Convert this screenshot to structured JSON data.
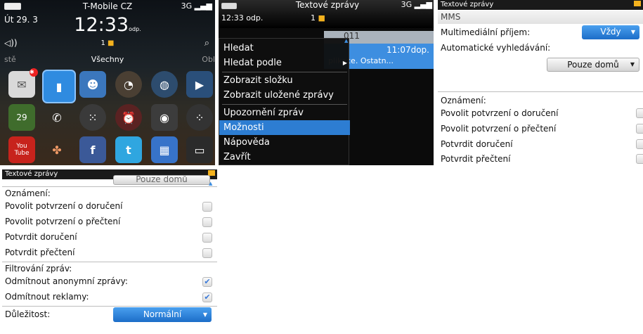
{
  "screen1": {
    "date": "Út 29. 3",
    "carrier": "T-Mobile CZ",
    "time": "12:33",
    "ampm": "odp.",
    "network": "3G",
    "message_count": "1",
    "tab_left": "stě",
    "tab_center": "Všechny",
    "tab_right": "Obl",
    "calendar_day": "29",
    "icons_row1": [
      "messages-icon",
      "phone-app-icon",
      "contacts-icon",
      "clock-speed-icon",
      "browser-icon",
      "media-play-icon"
    ],
    "icons_row2": [
      "calendar-icon",
      "call-icon",
      "bbm-icon",
      "alarm-icon",
      "camera-icon",
      "blackberry-icon"
    ],
    "icons_row3": [
      "youtube-icon",
      "network-icon",
      "facebook-icon",
      "twitter-icon",
      "app-world-icon",
      "messenger-icon"
    ],
    "youtube_label": "You Tube"
  },
  "screen2": {
    "app_title": "Textové zprávy",
    "clock": "12:33 odp.",
    "message_count": "1",
    "network": "3G",
    "date_fragment": "011",
    "selected_time": "11:07dop.",
    "selected_snippet": "plikace. Ostatn...",
    "menu_items": [
      {
        "label": "Hledat"
      },
      {
        "label": "Hledat podle"
      },
      {
        "label": "Zobrazit složku"
      },
      {
        "label": "Zobrazit uložené zprávy"
      },
      {
        "label": "Upozornění zpráv"
      },
      {
        "label": "Možnosti"
      },
      {
        "label": "Nápověda"
      },
      {
        "label": "Zavřít"
      }
    ]
  },
  "screen3": {
    "title": "Textové zprávy",
    "section": "MMS",
    "mm_receive_label": "Multimediální příjem:",
    "mm_receive_value": "Vždy",
    "auto_search_label": "Automatické vyhledávání:",
    "auto_search_value": "Pouze domů",
    "notifications_label": "Oznámení:",
    "options": [
      {
        "label": "Povolit potvrzení o doručení",
        "checked": false
      },
      {
        "label": "Povolit potvrzení o přečtení",
        "checked": false
      },
      {
        "label": "Potvrdit doručení",
        "checked": false
      },
      {
        "label": "Potvrdit přečtení",
        "checked": false
      }
    ]
  },
  "screen4": {
    "title": "Textové zprávy",
    "top_partial": "Pouze domů",
    "notifications_label": "Oznámení:",
    "options": [
      {
        "label": "Povolit potvrzení o doručení",
        "checked": false
      },
      {
        "label": "Povolit potvrzení o přečtení",
        "checked": false
      },
      {
        "label": "Potvrdit doručení",
        "checked": false
      },
      {
        "label": "Potvrdit přečtení",
        "checked": false
      }
    ],
    "filter_label": "Filtrování zpráv:",
    "filters": [
      {
        "label": "Odmítnout anonymní zprávy:",
        "checked": true
      },
      {
        "label": "Odmítnout reklamy:",
        "checked": true
      }
    ],
    "priority_label": "Důležitost:",
    "priority_value": "Normální"
  },
  "colors": {
    "accent_blue": "#2d7dd2",
    "dropdown_blue": "#1c6dc8",
    "header_dark": "#1a1a1a",
    "envelope": "#f4b21e"
  }
}
